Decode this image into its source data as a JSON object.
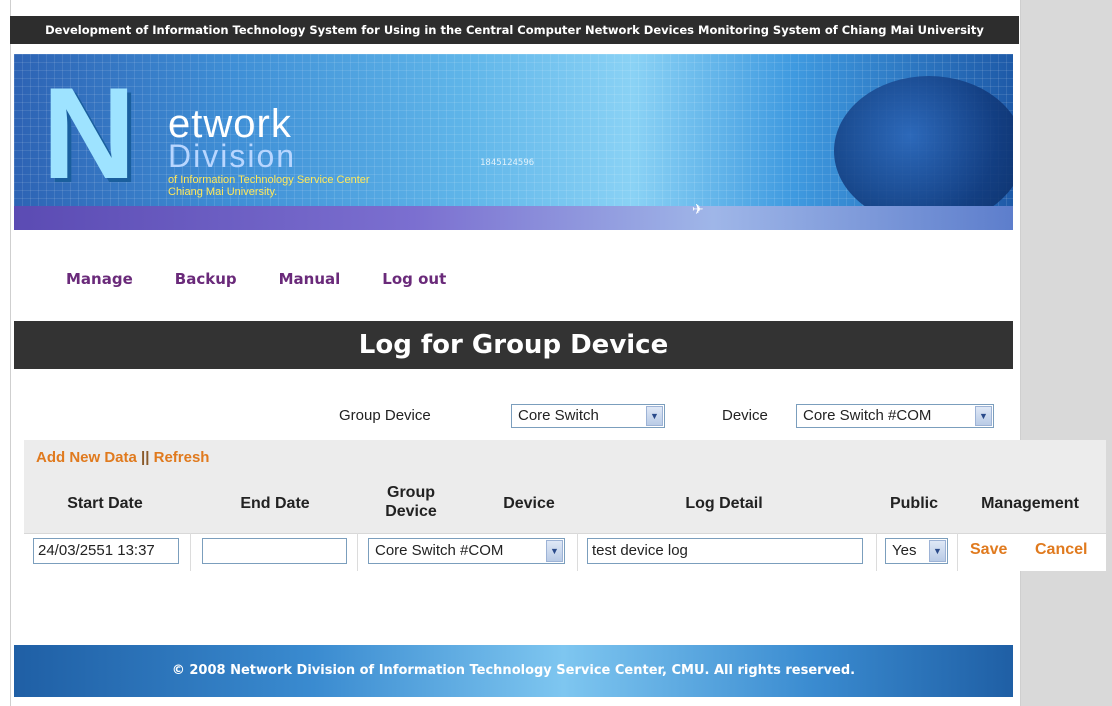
{
  "header": {
    "title": "Development of Information Technology System for Using in the Central Computer Network Devices Monitoring System of Chiang Mai University"
  },
  "banner": {
    "logo_big_letter": "N",
    "logo_word1": "etwork",
    "logo_word2": "Division",
    "logo_sub1": "of Information Technology Service Center",
    "logo_sub2": "Chiang Mai University.",
    "code_text": "1845124596"
  },
  "nav": {
    "items": [
      "Manage",
      "Backup",
      "Manual",
      "Log out"
    ]
  },
  "page": {
    "title": "Log for Group Device"
  },
  "filters": {
    "group_device_label": "Group Device",
    "group_device_value": "Core Switch",
    "device_label": "Device",
    "device_value": "Core Switch #COM"
  },
  "actions": {
    "add_new": "Add New Data",
    "separator": "||",
    "refresh": "Refresh"
  },
  "table": {
    "headers": {
      "start_date": "Start Date",
      "end_date": "End Date",
      "group_device_line1": "Group",
      "group_device_line2": "Device",
      "device": "Device",
      "log_detail": "Log Detail",
      "public": "Public",
      "management": "Management"
    },
    "row": {
      "start_date": "24/03/2551 13:37",
      "end_date": "",
      "group_device": "Core Switch #COM",
      "log_detail": "test device log",
      "public": "Yes",
      "save": "Save",
      "cancel": "Cancel"
    }
  },
  "footer": {
    "text": "© 2008 Network Division of Information Technology Service Center, CMU. All rights reserved."
  },
  "colors": {
    "nav_link": "#6a2a7a",
    "action_orange": "#e07a1e",
    "header_bar": "#333333"
  }
}
